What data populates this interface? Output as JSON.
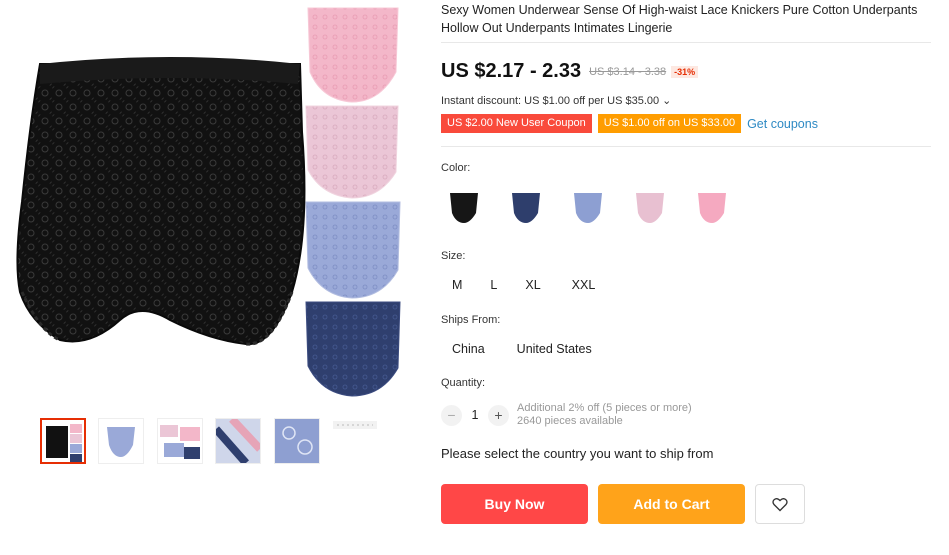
{
  "product": {
    "title": "Sexy Women Underwear Sense Of High-waist Lace Knickers Pure Cotton Underpants Hollow Out Underpants Intimates Lingerie",
    "price": "US $2.17 - 2.33",
    "original_price": "US $3.14 - 3.38",
    "discount": "-31%",
    "instant_discount": "Instant discount: US $1.00 off per US $35.00 ⌄",
    "coupons": [
      "US $2.00 New User Coupon",
      "US $1.00 off on US $33.00"
    ],
    "get_coupons_label": "Get coupons"
  },
  "gallery": {
    "main_image_icon": "lingerie-product-photo",
    "thumbnail_count": 6
  },
  "color": {
    "label": "Color:",
    "swatches": [
      "black",
      "navy",
      "light-blue",
      "light-pink",
      "pink"
    ],
    "swatch_colors": [
      "#161616",
      "#2e3e6c",
      "#8d9fd2",
      "#e8c0d1",
      "#f5a9c0"
    ]
  },
  "size": {
    "label": "Size:",
    "options": [
      "M",
      "L",
      "XL",
      "XXL"
    ]
  },
  "ships_from": {
    "label": "Ships From:",
    "options": [
      "China",
      "United States"
    ]
  },
  "quantity": {
    "label": "Quantity:",
    "minus": "−",
    "plus": "+",
    "value": "1",
    "note_line1": "Additional 2% off (5 pieces or more)",
    "note_line2": "2640 pieces available"
  },
  "ship_prompt": "Please select the country you want to ship from",
  "actions": {
    "buy_now": "Buy Now",
    "add_to_cart": "Add to Cart",
    "wishlist_icon": "heart-icon"
  },
  "colors": {
    "accent_red": "#ff4747",
    "accent_orange": "#ffa31a",
    "link_blue": "#2e8ac4"
  }
}
